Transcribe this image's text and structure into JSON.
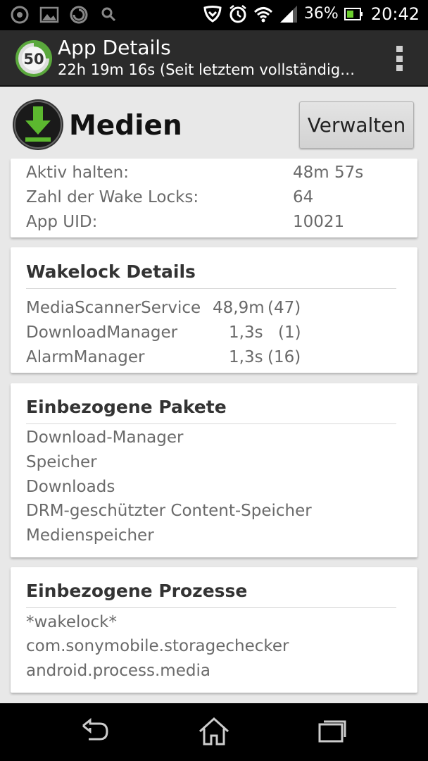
{
  "status_bar": {
    "battery_percent": "36%",
    "time": "20:42",
    "icons": [
      "power-icon",
      "image-icon",
      "sync-icon",
      "search-icon",
      "shield-icon",
      "alarm-icon",
      "wifi-icon",
      "signal-icon",
      "battery-icon"
    ]
  },
  "action_bar": {
    "badge_number": "50",
    "title": "App Details",
    "subtitle": "22h 19m 16s (Seit letztem vollständig…"
  },
  "app": {
    "name": "Medien",
    "manage_label": "Verwalten"
  },
  "summary": {
    "rows": [
      {
        "label": "Aktiv halten:",
        "value": "48m 57s"
      },
      {
        "label": "Zahl der Wake Locks:",
        "value": "64"
      },
      {
        "label": "App UID:",
        "value": "10021"
      }
    ]
  },
  "wakelock": {
    "title": "Wakelock Details",
    "rows": [
      {
        "name": "MediaScannerService",
        "time": "48,9m",
        "count": "(47)"
      },
      {
        "name": "DownloadManager",
        "time": "1,3s",
        "count": "(1)"
      },
      {
        "name": "AlarmManager",
        "time": "1,3s",
        "count": "(16)"
      }
    ]
  },
  "packages": {
    "title": "Einbezogene Pakete",
    "items": [
      "Download-Manager",
      "Speicher",
      "Downloads",
      "DRM-geschützter Content-Speicher",
      "Medienspeicher"
    ]
  },
  "processes": {
    "title": "Einbezogene Prozesse",
    "items": [
      "*wakelock*",
      "com.sonymobile.storagechecker",
      "android.process.media"
    ]
  },
  "colors": {
    "accent_green": "#4caf28",
    "action_bar": "#2b2b2b"
  }
}
